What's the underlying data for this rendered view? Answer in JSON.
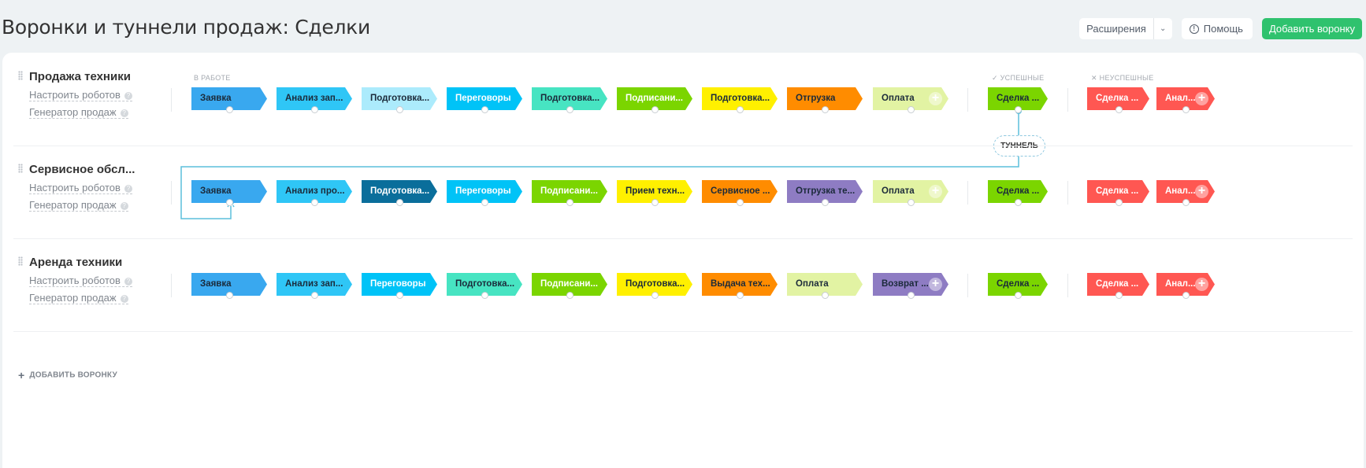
{
  "page": {
    "title": "Воронки и туннели продаж: Сделки",
    "extensions_label": "Расширения",
    "help_label": "Помощь",
    "add_funnel_label": "Добавить воронку"
  },
  "sections": {
    "in_work": "В РАБОТЕ",
    "success": "УСПЕШНЫЕ",
    "fail": "НЕУСПЕШНЫЕ"
  },
  "tunnel_label": "ТУННЕЛЬ",
  "add_funnel_bottom": "ДОБАВИТЬ ВОРОНКУ",
  "colors": {
    "accent_green": "#2fc26e",
    "tunnel_line": "#5cbfdb"
  },
  "funnels": [
    {
      "name": "Продажа техники",
      "robots": "Настроить роботов",
      "generator": "Генератор продаж",
      "stages": [
        {
          "label": "Заявка",
          "color": "#39a8ef",
          "text": "#1b2a3a"
        },
        {
          "label": "Анализ зап...",
          "color": "#2fc6f6",
          "text": "#1b2a3a"
        },
        {
          "label": "Подготовка...",
          "color": "#acebfc",
          "text": "#1b2a3a"
        },
        {
          "label": "Переговоры",
          "color": "#00c3f7",
          "text": "#ffffff"
        },
        {
          "label": "Подготовка...",
          "color": "#47e4c2",
          "text": "#1b2a3a"
        },
        {
          "label": "Подписани...",
          "color": "#7bd500",
          "text": "#ffffff"
        },
        {
          "label": "Подготовка...",
          "color": "#fff000",
          "text": "#1b2a3a"
        },
        {
          "label": "Отгрузка",
          "color": "#ff8c00",
          "text": "#1b2a3a"
        },
        {
          "label": "Оплата",
          "color": "#e2f3a3",
          "text": "#1b2a3a"
        }
      ],
      "success": [
        {
          "label": "Сделка ...",
          "color": "#7bd500",
          "text": "#1b2a3a"
        }
      ],
      "fail": [
        {
          "label": "Сделка ...",
          "color": "#ff5752",
          "text": "#ffffff"
        },
        {
          "label": "Анал...",
          "color": "#ff5752",
          "text": "#ffffff"
        }
      ]
    },
    {
      "name": "Сервисное обсл...",
      "robots": "Настроить роботов",
      "generator": "Генератор продаж",
      "stages": [
        {
          "label": "Заявка",
          "color": "#39a8ef",
          "text": "#1b2a3a"
        },
        {
          "label": "Анализ про...",
          "color": "#2fc6f6",
          "text": "#1b2a3a"
        },
        {
          "label": "Подготовка...",
          "color": "#0a6e9b",
          "text": "#ffffff"
        },
        {
          "label": "Переговоры",
          "color": "#00c3f7",
          "text": "#ffffff"
        },
        {
          "label": "Подписани...",
          "color": "#7bd500",
          "text": "#ffffff"
        },
        {
          "label": "Прием техн...",
          "color": "#fff000",
          "text": "#1b2a3a"
        },
        {
          "label": "Сервисное ...",
          "color": "#ff8c00",
          "text": "#1b2a3a"
        },
        {
          "label": "Отгрузка те...",
          "color": "#8e7cc3",
          "text": "#1b2a3a"
        },
        {
          "label": "Оплата",
          "color": "#e2f3a3",
          "text": "#1b2a3a"
        }
      ],
      "success": [
        {
          "label": "Сделка ...",
          "color": "#7bd500",
          "text": "#1b2a3a"
        }
      ],
      "fail": [
        {
          "label": "Сделка ...",
          "color": "#ff5752",
          "text": "#ffffff"
        },
        {
          "label": "Анал...",
          "color": "#ff5752",
          "text": "#ffffff"
        }
      ]
    },
    {
      "name": "Аренда техники",
      "robots": "Настроить роботов",
      "generator": "Генератор продаж",
      "stages": [
        {
          "label": "Заявка",
          "color": "#39a8ef",
          "text": "#1b2a3a"
        },
        {
          "label": "Анализ зап...",
          "color": "#2fc6f6",
          "text": "#1b2a3a"
        },
        {
          "label": "Переговоры",
          "color": "#00c3f7",
          "text": "#ffffff"
        },
        {
          "label": "Подготовка...",
          "color": "#47e4c2",
          "text": "#1b2a3a"
        },
        {
          "label": "Подписани...",
          "color": "#7bd500",
          "text": "#ffffff"
        },
        {
          "label": "Подготовка...",
          "color": "#fff000",
          "text": "#1b2a3a"
        },
        {
          "label": "Выдача тех...",
          "color": "#ff8c00",
          "text": "#1b2a3a"
        },
        {
          "label": "Оплата",
          "color": "#e2f3a3",
          "text": "#1b2a3a"
        },
        {
          "label": "Возврат ...",
          "color": "#8e7cc3",
          "text": "#1b2a3a"
        }
      ],
      "success": [
        {
          "label": "Сделка ...",
          "color": "#7bd500",
          "text": "#1b2a3a"
        }
      ],
      "fail": [
        {
          "label": "Сделка ...",
          "color": "#ff5752",
          "text": "#ffffff"
        },
        {
          "label": "Анал...",
          "color": "#ff5752",
          "text": "#ffffff"
        }
      ]
    }
  ]
}
